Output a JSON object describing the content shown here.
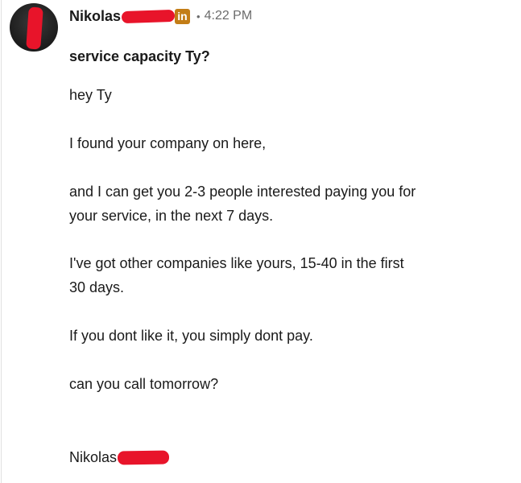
{
  "message": {
    "sender": {
      "name": "Nikolas",
      "network_badge": "in",
      "timestamp": "4:22 PM"
    },
    "subject": "service capacity Ty?",
    "body_lines": [
      "hey Ty",
      "I found your company on here,",
      "and I can get you 2-3 people interested paying you for",
      "your service, in the next 7 days.",
      "I've got other companies like yours, 15-40 in the first",
      "30 days.",
      "If you dont like it, you simply dont pay.",
      "can you call tomorrow?"
    ],
    "signature": "Nikolas",
    "separator": "•"
  },
  "colors": {
    "redaction": "#e8142a",
    "badge": "#c37d16",
    "meta_text": "#6b6b6b"
  }
}
